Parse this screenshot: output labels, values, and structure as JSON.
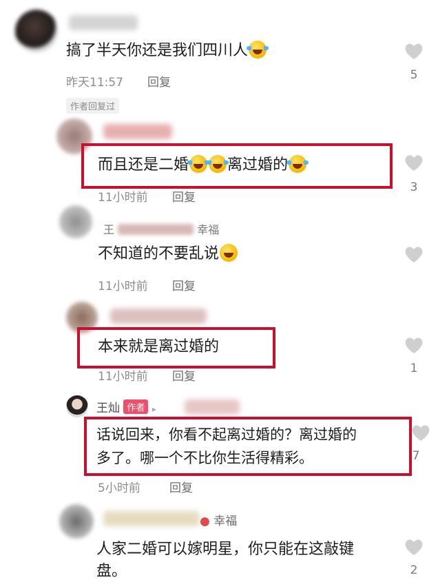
{
  "comments": [
    {
      "text": "搞了半天你还是我们四川人",
      "time": "昨天11:57",
      "reply": "回复",
      "likes": "5",
      "tag": "作者回复过"
    },
    {
      "text": "而且还是二婚",
      "text_tail": "离过婚的",
      "time": "11小时前",
      "reply": "回复",
      "likes": "3"
    },
    {
      "name_suffix": "幸福",
      "name_prefix": "王",
      "text": "不知道的不要乱说",
      "time": "11小时前",
      "reply": "回复",
      "likes": ""
    },
    {
      "text": "本来就是离过婚的",
      "time": "11小时前",
      "reply": "回复",
      "likes": "1"
    },
    {
      "name": "王灿",
      "author_label": "作者",
      "line1": "话说回来，你看不起离过婚的？离过婚的",
      "line2": "多了。哪一个不比你生活得精彩。",
      "time": "5小时前",
      "reply": "回复",
      "likes": "7"
    },
    {
      "name_suffix": "幸福",
      "line1": "人家二婚可以嫁明星，你只能在这敲键",
      "line2": "盘。",
      "likes": "2"
    }
  ],
  "icons": {
    "like": "heart-outline-icon",
    "laugh": "laugh-cry-emoji",
    "grin": "grin-emoji"
  },
  "colors": {
    "highlight_box": "#c8102e",
    "author_tag": "#f04f6a"
  }
}
